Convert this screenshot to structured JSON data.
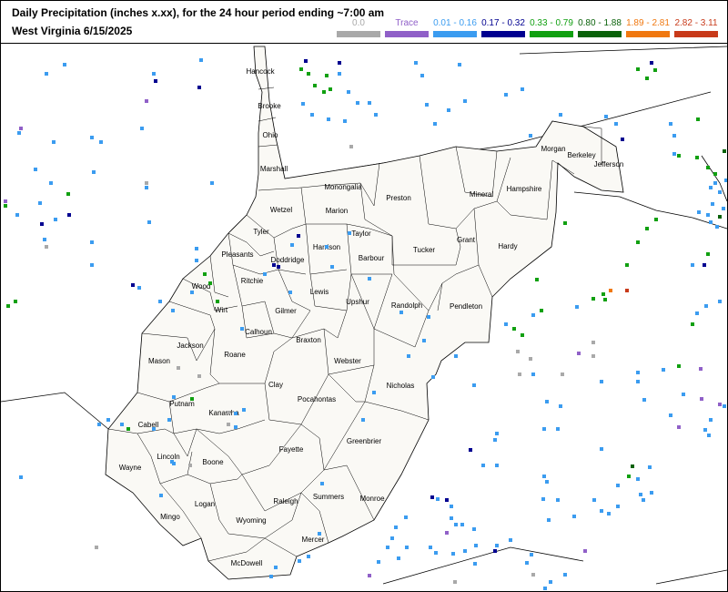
{
  "title_line1": "Daily Precipitation (inches  x.xx),  for the 24 hour period ending ~7:00 am",
  "title_line2": "West Virginia 6/15/2025",
  "legend": [
    {
      "label": "0.0",
      "color": "#a9a9a9"
    },
    {
      "label": "Trace",
      "color": "#9060c8"
    },
    {
      "label": "0.01 - 0.16",
      "color": "#3b9cf0"
    },
    {
      "label": "0.17 - 0.32",
      "color": "#000090"
    },
    {
      "label": "0.33 - 0.79",
      "color": "#11a011"
    },
    {
      "label": "0.80 - 1.88",
      "color": "#0a620a"
    },
    {
      "label": "1.89 - 2.81",
      "color": "#f07810"
    },
    {
      "label": "2.82 - 3.11",
      "color": "#c83a1a"
    }
  ],
  "counties": [
    "Hancock",
    "Brooke",
    "Ohio",
    "Marshall",
    "Wetzel",
    "Monongalia",
    "Preston",
    "Marion",
    "Tyler",
    "Pleasants",
    "Doddridge",
    "Harrison",
    "Taylor",
    "Barbour",
    "Tucker",
    "Mineral",
    "Hampshire",
    "Morgan",
    "Berkeley",
    "Jefferson",
    "Grant",
    "Hardy",
    "Wood",
    "Ritchie",
    "Wirt",
    "Lewis",
    "Upshur",
    "Randolph",
    "Pendleton",
    "Gilmer",
    "Calhoun",
    "Jackson",
    "Roane",
    "Mason",
    "Braxton",
    "Webster",
    "Clay",
    "Pocahontas",
    "Nicholas",
    "Putnam",
    "Cabell",
    "Kanawha",
    "Wayne",
    "Lincoln",
    "Boone",
    "Fayette",
    "Greenbrier",
    "Logan",
    "Raleigh",
    "Summers",
    "Monroe",
    "Mingo",
    "Wyoming",
    "Mercer",
    "McDowell"
  ]
}
